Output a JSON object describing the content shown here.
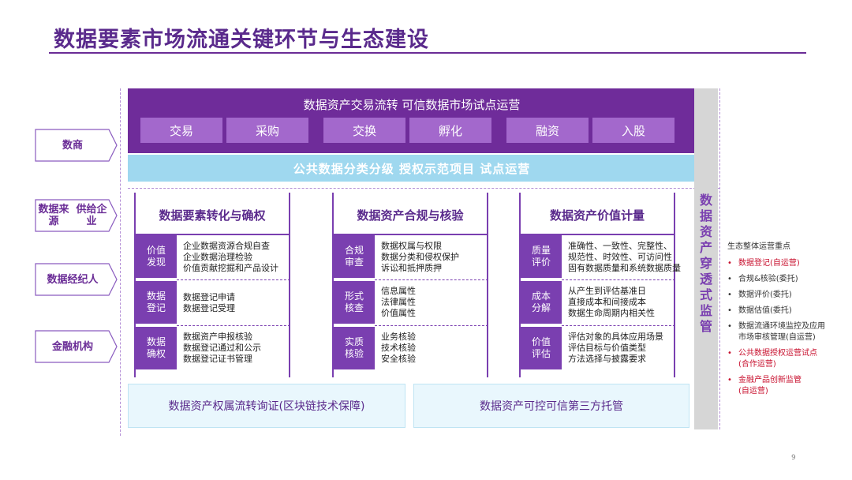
{
  "title": "数据要素市场流通关键环节与生态建设",
  "left_tags": [
    "数商",
    "数据来源\n供给企业",
    "数据经纪人",
    "金融机构"
  ],
  "banner": {
    "title": "数据资产交易流转  可信数据市场试点运营",
    "buttons": [
      "交易",
      "采购",
      "交换",
      "孵化",
      "融资",
      "入股"
    ]
  },
  "public_bar": "公共数据分类分级  授权示范项目  试点运营",
  "side_label": "数据资产穿透式监管",
  "panels": [
    {
      "title": "数据要素转化与确权",
      "rows": [
        {
          "tag": "价值\n发现",
          "text": "企业数据资源合规自查\n企业数据治理检验\n价值贡献挖掘和产品设计"
        },
        {
          "tag": "数据\n登记",
          "text": "数据登记申请\n数据登记受理"
        },
        {
          "tag": "数据\n确权",
          "text": "数据资产申报核验\n数据登记通过和公示\n数据登记证书管理"
        }
      ]
    },
    {
      "title": "数据资产合规与核验",
      "rows": [
        {
          "tag": "合规\n审查",
          "text": "数据权属与权限\n数据分类和侵权保护\n诉讼和抵押质押"
        },
        {
          "tag": "形式\n核查",
          "text": "信息属性\n法律属性\n价值属性"
        },
        {
          "tag": "实质\n核验",
          "text": "业务核验\n技术核验\n安全核验"
        }
      ]
    },
    {
      "title": "数据资产价值计量",
      "rows": [
        {
          "tag": "质量\n评价",
          "text": "准确性、一致性、完整性、\n规范性、时效性、可访问性\n固有数据质量和系统数据质量"
        },
        {
          "tag": "成本\n分解",
          "text": "从产生到评估基准日\n直接成本和间接成本\n数据生命周期内相关性"
        },
        {
          "tag": "价值\n评估",
          "text": "评估对象的具体应用场景\n评估目标与价值类型\n方法选择与披露要求"
        }
      ]
    }
  ],
  "bottom_boxes": [
    "数据资产权属流转询证(区块链技术保障)",
    "数据资产可控可信第三方托管"
  ],
  "right_list": {
    "heading": "生态整体运营重点",
    "items": [
      {
        "text": "数据登记(自运营)",
        "red": true
      },
      {
        "text": "合规&核验(委托)",
        "red": false
      },
      {
        "text": "数据评价(委托)",
        "red": false
      },
      {
        "text": "数据估值(委托)",
        "red": false
      },
      {
        "text": "数据流通环境监控及应用\n市场审核管理(自运营)",
        "red": false
      },
      {
        "text": "公共数据授权运营试点\n(合作运营)",
        "red": true
      },
      {
        "text": "金融产品创新监管\n(自运营)",
        "red": true
      }
    ]
  },
  "page_number": "9",
  "colors": {
    "purple": "#6f2c9a",
    "light_purple": "#a368cc",
    "light_blue": "#9fd8ef",
    "red": "#c8102e"
  }
}
